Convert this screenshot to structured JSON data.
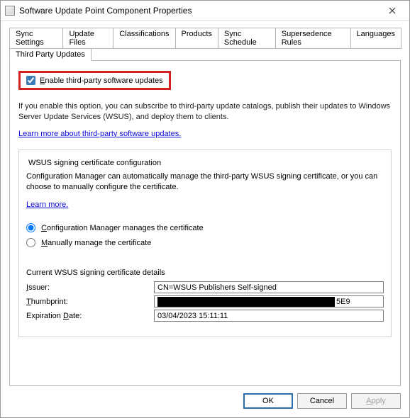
{
  "window": {
    "title": "Software Update Point Component Properties"
  },
  "tabs": {
    "row1": [
      {
        "label": "Sync Settings"
      },
      {
        "label": "Update Files"
      },
      {
        "label": "Classifications"
      },
      {
        "label": "Products"
      },
      {
        "label": "Sync Schedule"
      },
      {
        "label": "Supersedence Rules"
      },
      {
        "label": "Languages"
      }
    ],
    "row2": [
      {
        "label": "Third Party Updates"
      }
    ]
  },
  "panel": {
    "enable_checkbox": {
      "prefix": "E",
      "rest": "nable third-party software updates",
      "checked": true
    },
    "description": "If you enable this option, you can subscribe to third-party update catalogs, publish their updates to Windows Server Update Services (WSUS), and deploy them to clients.",
    "learn_link": "Learn more about third-party software updates."
  },
  "group": {
    "title": "WSUS signing certificate configuration",
    "description": "Configuration Manager can automatically manage the third-party WSUS signing certificate, or you can choose to manually configure the certificate.",
    "learn_link": "Learn more.",
    "radio1": {
      "prefix": "C",
      "rest": "onfiguration Manager manages the certificate"
    },
    "radio2": {
      "prefix": "M",
      "rest": "anually manage the certificate"
    },
    "cert": {
      "section_title": "Current WSUS signing certificate details",
      "issuer_lbl_prefix": "I",
      "issuer_lbl_rest": "ssuer:",
      "issuer_val": "CN=WSUS Publishers Self-signed",
      "thumb_lbl_prefix": "T",
      "thumb_lbl_rest": "humbprint:",
      "thumb_suffix": "5E9",
      "exp_lbl": "Expiration ",
      "exp_lbl_ul": "D",
      "exp_lbl_rest": "ate:",
      "exp_val": "03/04/2023 15:11:11"
    }
  },
  "buttons": {
    "ok": "OK",
    "cancel": "Cancel",
    "apply": {
      "ul": "A",
      "rest": "pply"
    }
  }
}
